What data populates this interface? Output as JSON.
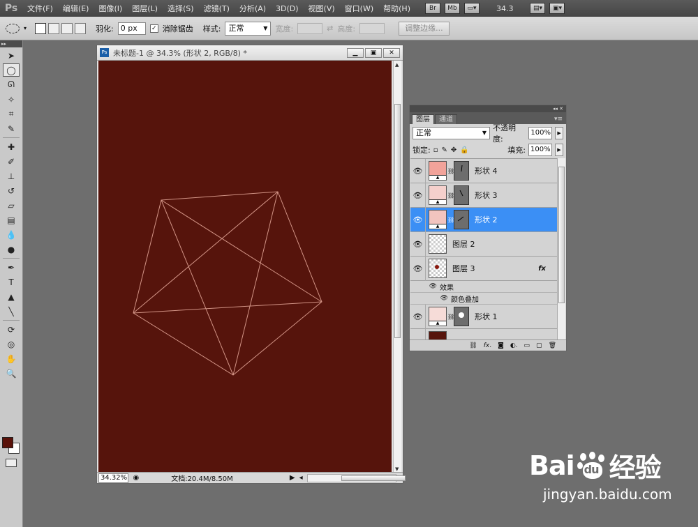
{
  "menubar": {
    "logo": "Ps",
    "items": [
      "文件(F)",
      "编辑(E)",
      "图像(I)",
      "图层(L)",
      "选择(S)",
      "滤镜(T)",
      "分析(A)",
      "3D(D)",
      "视图(V)",
      "窗口(W)",
      "帮助(H)"
    ],
    "btn_br": "Br",
    "btn_mb": "Mb",
    "zoom": "34.3"
  },
  "options": {
    "feather_label": "羽化:",
    "feather_value": "0 px",
    "antialias_label": "消除锯齿",
    "antialias_checked": "✓",
    "style_label": "样式:",
    "style_value": "正常",
    "width_label": "宽度:",
    "height_label": "高度:",
    "refine_edge_button": "调整边缘..."
  },
  "document": {
    "icon": "Ps",
    "title": "未标题-1 @ 34.3% (形状 2, RGB/8) *",
    "canvas_color": "#56140c",
    "zoom": "34.32%",
    "doc_info": "文档:20.4M/8.50M"
  },
  "layers_panel": {
    "tabs": [
      "图层",
      "通道"
    ],
    "blend_mode": "正常",
    "opacity_label": "不透明度:",
    "opacity_value": "100%",
    "lock_label": "锁定:",
    "fill_label": "填充:",
    "fill_value": "100%",
    "layers": [
      {
        "name": "形状 4",
        "type": "shape",
        "color": "#f2a39a",
        "selected": false
      },
      {
        "name": "形状 3",
        "type": "shape",
        "color": "#f5d0cc",
        "selected": false
      },
      {
        "name": "形状 2",
        "type": "shape",
        "color": "#f2c4bf",
        "selected": true
      },
      {
        "name": "图层 2",
        "type": "pixel",
        "selected": false
      },
      {
        "name": "图层 3",
        "type": "pixel",
        "fx": "fx",
        "selected": false
      },
      {
        "name": "形状 1",
        "type": "shape",
        "color": "#f6dcd8",
        "selected": false
      }
    ],
    "effects_label": "效果",
    "color_overlay_label": "颜色叠加"
  },
  "watermark": {
    "main_left": "Bai",
    "main_right": "经验",
    "paw_letters": "du",
    "sub": "jingyan.baidu.com"
  }
}
